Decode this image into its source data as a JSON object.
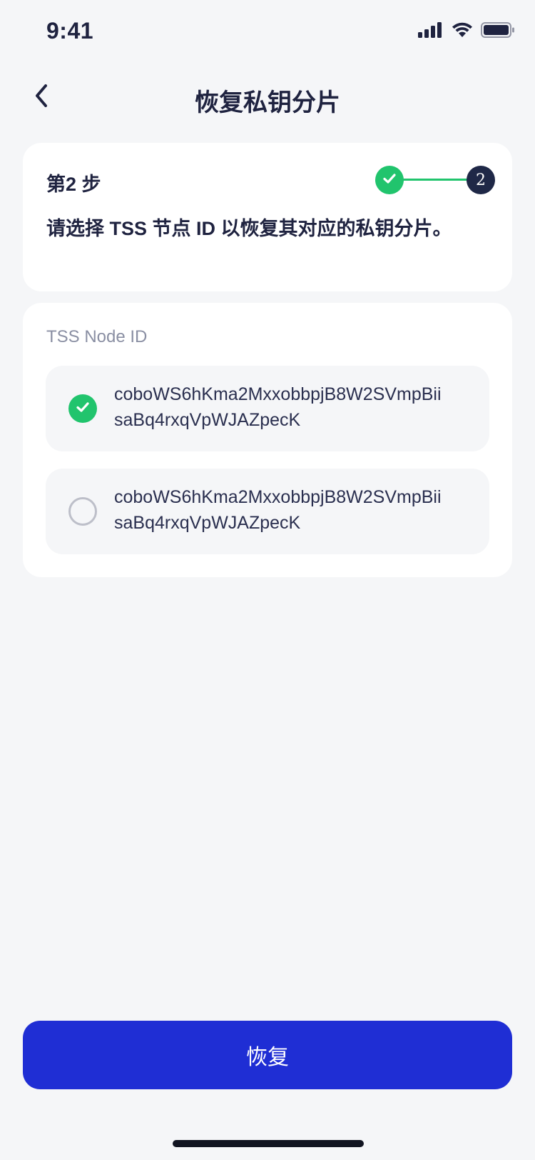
{
  "status_bar": {
    "time": "9:41",
    "icons": [
      "signal-icon",
      "wifi-icon",
      "battery-icon"
    ]
  },
  "nav": {
    "back_icon": "chevron-left-icon",
    "title": "恢复私钥分片"
  },
  "step": {
    "label": "第2 步",
    "description": "请选择 TSS 节点 ID 以恢复其对应的私钥分片。",
    "completed_icon": "check-icon",
    "current_number": "2"
  },
  "nodes": {
    "label": "TSS Node ID",
    "options": [
      {
        "id_line1": "coboWS6hKma2MxxobbpjB8W2SVmpBii",
        "id_line2": "saBq4rxqVpWJAZpecK",
        "selected": true
      },
      {
        "id_line1": "coboWS6hKma2MxxobbpjB8W2SVmpBii",
        "id_line2": "saBq4rxqVpWJAZpecK",
        "selected": false
      }
    ]
  },
  "actions": {
    "restore_label": "恢复"
  },
  "colors": {
    "accent": "#1F2ED4",
    "success": "#21C46D",
    "text_primary": "#1F2340",
    "text_secondary": "#8A8FA3",
    "background": "#F5F6F8"
  }
}
